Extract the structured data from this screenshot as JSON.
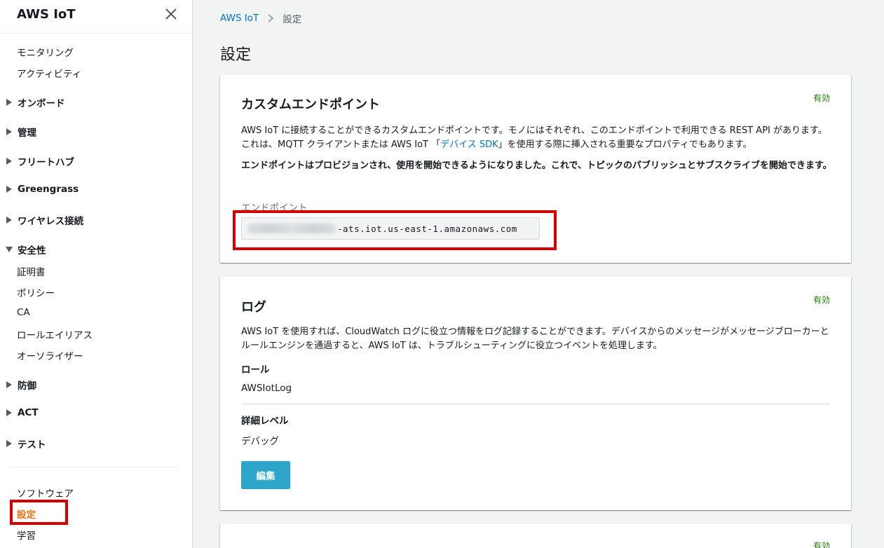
{
  "sidebar": {
    "title": "AWS IoT",
    "items": {
      "monitoring": "モニタリング",
      "activity": "アクティビティ",
      "onboard": "オンボード",
      "manage": "管理",
      "fleet_hub": "フリートハブ",
      "greengrass": "Greengrass",
      "wireless": "ワイヤレス接続",
      "security": "安全性",
      "certificates": "証明書",
      "policies": "ポリシー",
      "ca": "CA",
      "role_aliases": "ロールエイリアス",
      "authorizers": "オーソライザー",
      "defend": "防御",
      "act": "ACT",
      "test": "テスト",
      "software": "ソフトウェア",
      "settings": "設定",
      "learn": "学習"
    }
  },
  "breadcrumb": {
    "root": "AWS IoT",
    "current": "設定"
  },
  "page_title": "設定",
  "custom_endpoint": {
    "title": "カスタムエンドポイント",
    "status": "有効",
    "desc_part1": "AWS IoT に接続することができるカスタムエンドポイントです。モノにはそれぞれ、このエンドポイントで利用できる REST API があります。これは、MQTT クライアントまたは AWS IoT 「",
    "desc_link": "デバイス SDK",
    "desc_part2": "」を使用する際に挿入される重要なプロパティでもあります。",
    "bold_text": "エンドポイントはプロビジョンされ、使用を開始できるようになりました。これで、トピックのパブリッシュとサブスクライブを開始できます。",
    "endpoint_label": "エンドポイント",
    "endpoint_value": "-ats.iot.us-east-1.amazonaws.com"
  },
  "logs": {
    "title": "ログ",
    "status": "有効",
    "desc": "AWS IoT を使用すれば、CloudWatch ログに役立つ情報をログ記録することができます。デバイスからのメッセージがメッセージブローカーとルールエンジンを通過すると、AWS IoT は、トラブルシューティングに役立つイベントを処理します。",
    "role_label": "ロール",
    "role_value": "AWSIotLog",
    "level_label": "詳細レベル",
    "level_value": "デバッグ",
    "edit_button": "編集"
  },
  "third_card": {
    "status": "有効"
  },
  "colors": {
    "accent": "#0073bb",
    "active_nav": "#ec7211",
    "success": "#1d8102",
    "button": "#2ea6c9",
    "highlight": "#d40000"
  }
}
